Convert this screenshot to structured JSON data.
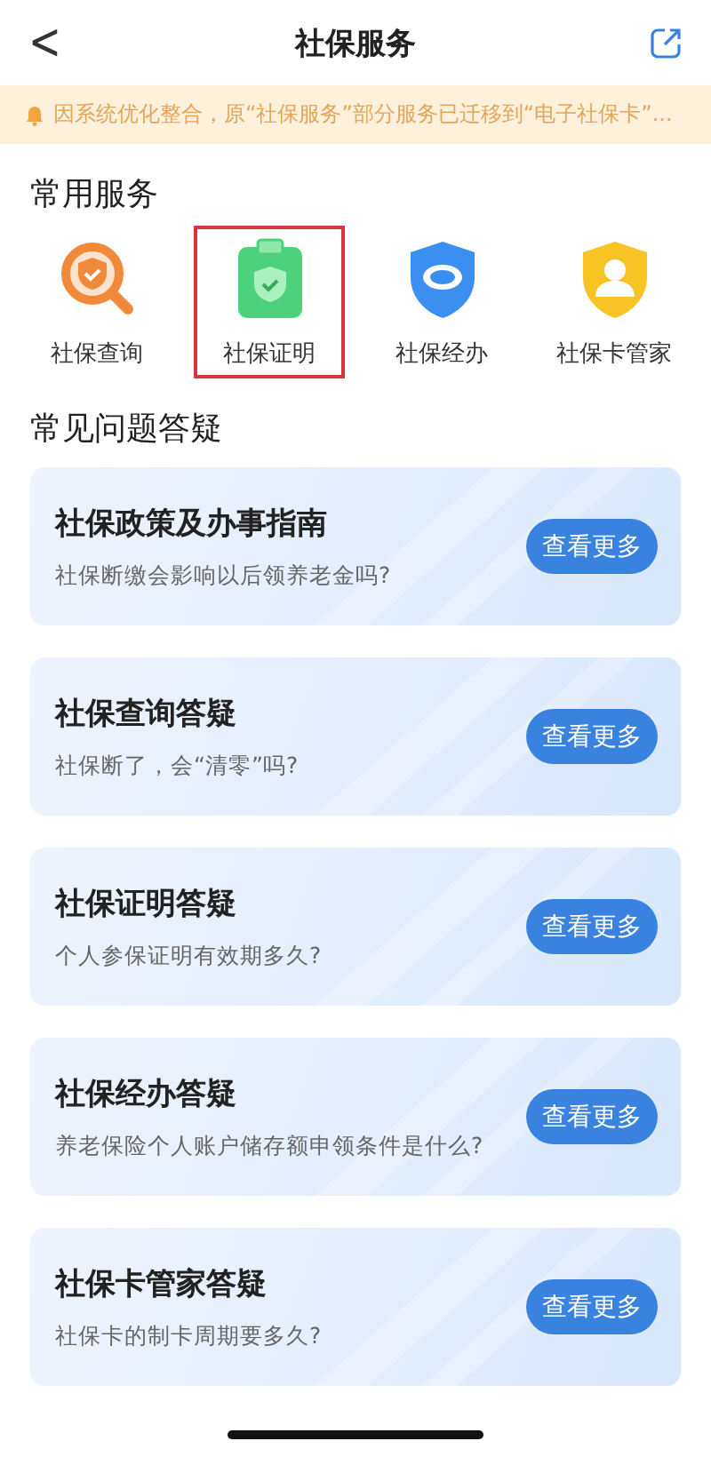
{
  "nav": {
    "back": "<",
    "title": "社保服务"
  },
  "notice": {
    "text": "因系统优化整合，原“社保服务”部分服务已迁移到“电子社保卡”..."
  },
  "services_title": "常用服务",
  "services": [
    {
      "kind": "search",
      "label": "社保查询",
      "highlighted": false
    },
    {
      "kind": "certificate",
      "label": "社保证明",
      "highlighted": true
    },
    {
      "kind": "handle",
      "label": "社保经办",
      "highlighted": false
    },
    {
      "kind": "card",
      "label": "社保卡管家",
      "highlighted": false
    }
  ],
  "faq_title": "常见问题答疑",
  "faq": [
    {
      "title": "社保政策及办事指南",
      "question": "社保断缴会影响以后领养老金吗?",
      "button": "查看更多"
    },
    {
      "title": "社保查询答疑",
      "question": "社保断了，会“清零”吗?",
      "button": "查看更多"
    },
    {
      "title": "社保证明答疑",
      "question": "个人参保证明有效期多久?",
      "button": "查看更多"
    },
    {
      "title": "社保经办答疑",
      "question": "养老保险个人账户储存额申领条件是什么?",
      "button": "查看更多"
    },
    {
      "title": "社保卡管家答疑",
      "question": "社保卡的制卡周期要多久?",
      "button": "查看更多"
    }
  ]
}
